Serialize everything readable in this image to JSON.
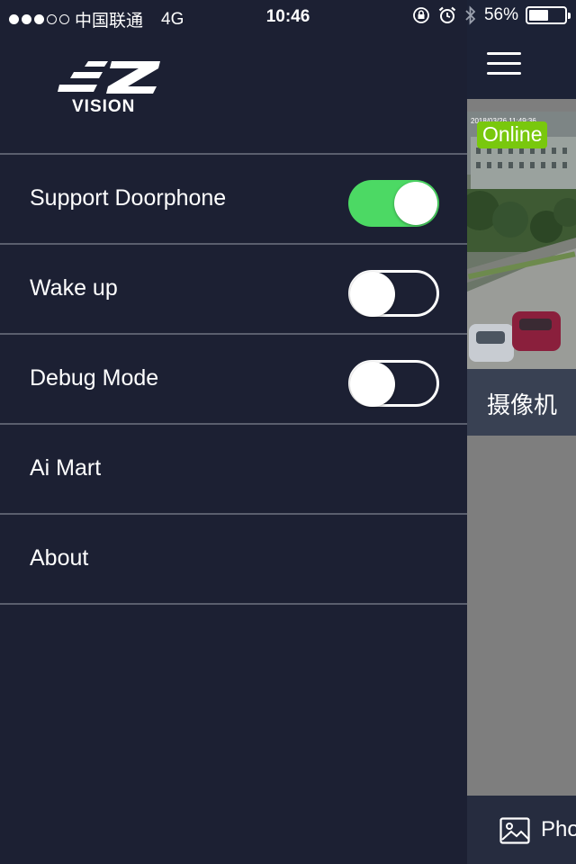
{
  "status_bar": {
    "carrier": "中国联通",
    "network": "4G",
    "time": "10:46",
    "battery_percent": "56%",
    "battery_level": 0.56,
    "signal_bars_filled": 3,
    "signal_bars_total": 5
  },
  "drawer": {
    "logo_text": "VISION",
    "items": [
      {
        "label": "Support Doorphone",
        "has_toggle": true,
        "toggle_on": true
      },
      {
        "label": "Wake up",
        "has_toggle": true,
        "toggle_on": false
      },
      {
        "label": "Debug Mode",
        "has_toggle": true,
        "toggle_on": false
      },
      {
        "label": "Ai Mart",
        "has_toggle": false
      },
      {
        "label": "About",
        "has_toggle": false
      }
    ]
  },
  "main": {
    "camera": {
      "status": "Online",
      "name": "摄像机",
      "timestamp_overlay": "2018/03/26 11:49:36"
    },
    "bottom_bar": {
      "label": "Pho"
    }
  },
  "colors": {
    "drawer_bg": "#1c2033",
    "divider": "#5a5f6e",
    "toggle_on": "#4cd964",
    "online_badge": "#79c80d",
    "camera_label_bar": "#394153",
    "bottom_bar": "#262c3f"
  }
}
